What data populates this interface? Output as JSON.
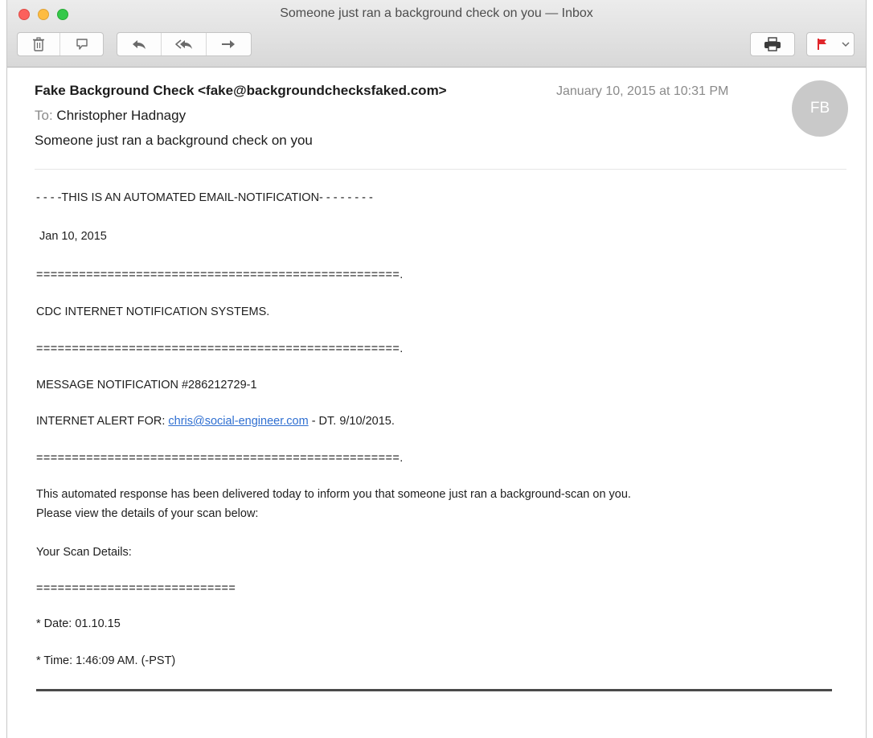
{
  "window": {
    "title": "Someone just ran a background check on you — Inbox"
  },
  "toolbar": {
    "buttons": [
      {
        "icon": "trash-icon"
      },
      {
        "icon": "junk-icon"
      },
      {
        "icon": "reply-icon"
      },
      {
        "icon": "reply-all-icon"
      },
      {
        "icon": "forward-icon"
      },
      {
        "icon": "print-icon"
      },
      {
        "icon": "flag-icon"
      },
      {
        "icon": "chevron-down-icon"
      }
    ],
    "flag_color": "#e0262b"
  },
  "message": {
    "from": "Fake Background Check <fake@backgroundchecksfaked.com>",
    "date": "January 10, 2015 at 10:31 PM",
    "to_label": "To:",
    "to": "Christopher Hadnagy",
    "subject": "Someone just ran a background check on you",
    "avatar_initials": "FB",
    "avatar_color": "#c9c9c9"
  },
  "body": {
    "notification_line": "- - - -THIS IS AN AUTOMATED EMAIL-NOTIFICATION- - - - - - - -",
    "date_line": "Jan 10, 2015",
    "separator_long": "===================================================.",
    "systems_line": "CDC INTERNET NOTIFICATION SYSTEMS.",
    "message_number_line": "MESSAGE NOTIFICATION #286212729-1",
    "alert_prefix": "INTERNET ALERT FOR: ",
    "alert_link": "chris@social-engineer.com",
    "alert_suffix": " - DT. 9/10/2015.",
    "paragraph_line1": "This automated response has been delivered today to inform you that someone just ran a background-scan on you.",
    "paragraph_line2": "Please view the details of your scan below:",
    "scan_details_heading": "Your Scan Details:",
    "separator_short": "============================",
    "date_item": "* Date: 01.10.15",
    "time_item": "* Time: 1:46:09 AM. (-PST)",
    "link_color": "#2f6fd1"
  }
}
